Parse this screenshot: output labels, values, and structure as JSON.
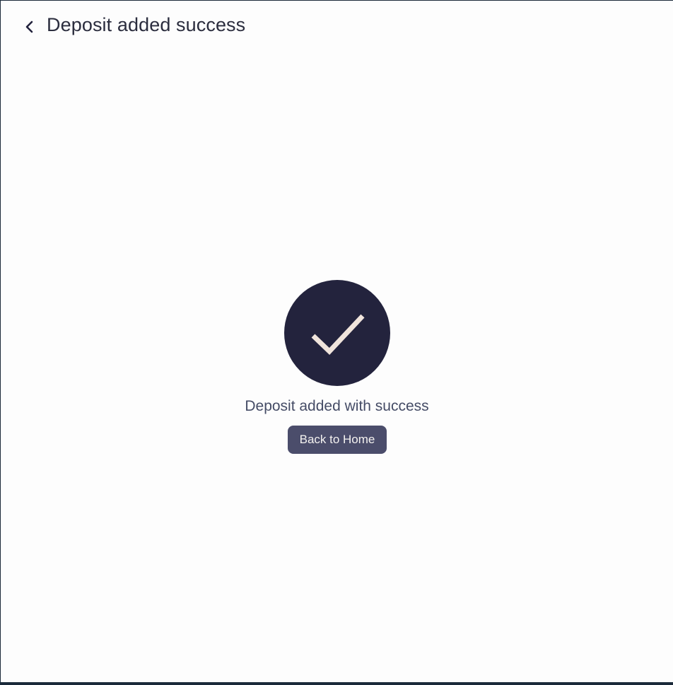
{
  "header": {
    "title": "Deposit added success",
    "back_icon": "chevron-left-icon"
  },
  "main": {
    "status_icon": "checkmark-icon",
    "message": "Deposit added with success",
    "home_button_label": "Back to Home"
  },
  "colors": {
    "background": "#fdfdfd",
    "frame_border": "#1b2a3a",
    "title_text": "#2b2d3e",
    "circle": "#23233d",
    "checkmark": "#f0e4dc",
    "message_text": "#454c66",
    "button_bg": "#4b4d6b",
    "button_text": "#f4f2f0"
  }
}
